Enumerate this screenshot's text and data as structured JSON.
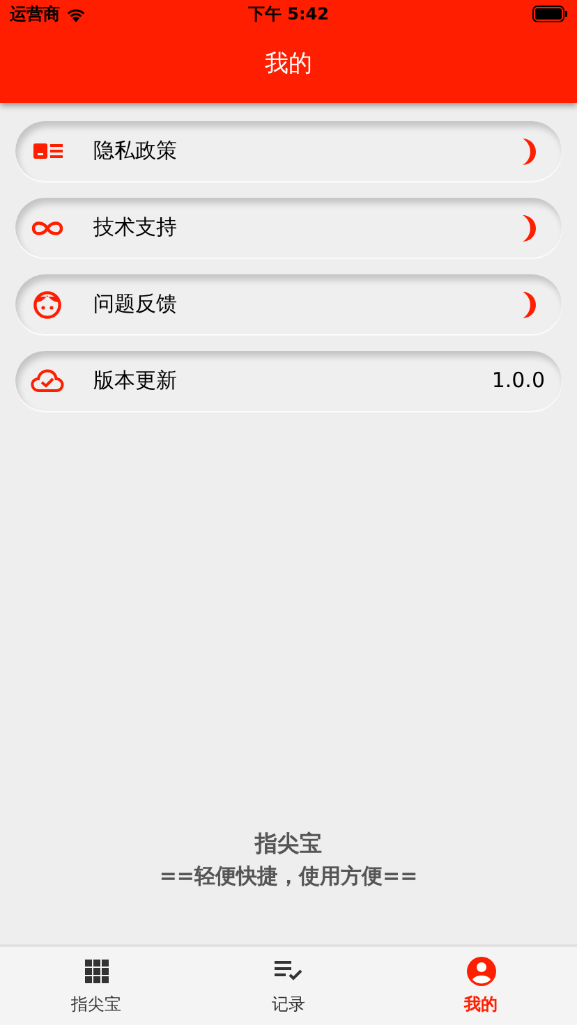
{
  "status_bar": {
    "carrier": "运营商",
    "time": "下午 5:42"
  },
  "header": {
    "title": "我的"
  },
  "menu": [
    {
      "label": "隐私政策",
      "kind": "arrow"
    },
    {
      "label": "技术支持",
      "kind": "arrow"
    },
    {
      "label": "问题反馈",
      "kind": "arrow"
    },
    {
      "label": "版本更新",
      "kind": "value",
      "value": "1.0.0"
    }
  ],
  "footer": {
    "app_name": "指尖宝",
    "slogan": "==轻便快捷，使用方便=="
  },
  "tabs": [
    {
      "label": "指尖宝",
      "selected": false
    },
    {
      "label": "记录",
      "selected": false
    },
    {
      "label": "我的",
      "selected": true
    }
  ]
}
